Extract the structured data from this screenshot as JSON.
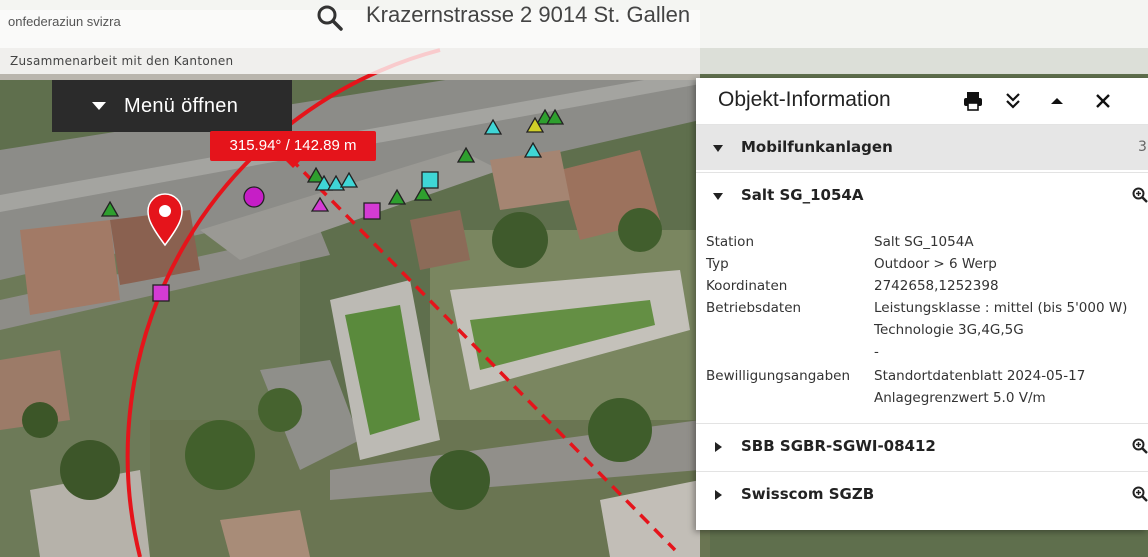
{
  "header": {
    "confederation_text": "onfederaziun svizra",
    "search_text": "Krazernstrasse 2 9014 St. Gallen",
    "collaboration_text": "Zusammenarbeit mit den Kantonen"
  },
  "map": {
    "menu_label": "Menü öffnen",
    "measurement_label": "315.94° / 142.89 m",
    "colors": {
      "measurement": "#e5141b",
      "antenna_green": "#2e9f2e",
      "antenna_cyan": "#3fd6d6",
      "marker_magenta": "#d43bd4"
    }
  },
  "panel": {
    "title": "Objekt-Information",
    "header_icons": [
      "print-icon",
      "double-chevron-down-icon",
      "collapse-up-icon",
      "close-icon"
    ],
    "category": {
      "label": "Mobilfunkanlagen",
      "count": "3"
    },
    "expanded_item": {
      "label": "Salt SG_1054A"
    },
    "details": [
      {
        "key": "Station",
        "value": "Salt SG_1054A"
      },
      {
        "key": "Typ",
        "value": "Outdoor > 6 Werp"
      },
      {
        "key": "Koordinaten",
        "value": "2742658,1252398"
      },
      {
        "key": "Betriebsdaten",
        "value": "Leistungsklasse : mittel (bis 5'000 W)",
        "value2": "Technologie 3G,4G,5G",
        "value3": "-"
      },
      {
        "key": "Bewilligungsangaben",
        "value": "Standortdatenblatt 2024-05-17",
        "value2": "Anlagegrenzwert 5.0 V/m"
      }
    ],
    "collapsed_items": [
      {
        "label": "SBB SGBR-SGWI-08412"
      },
      {
        "label": "Swisscom SGZB"
      }
    ]
  }
}
